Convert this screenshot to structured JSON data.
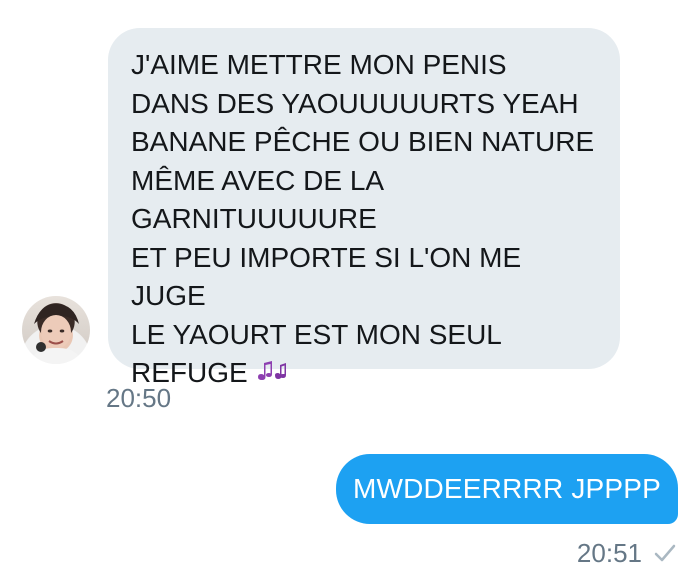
{
  "received_message": {
    "text": "J'AIME METTRE MON PENIS\nDANS DES YAOUUUUURTS YEAH\nBANANE PÊCHE OU BIEN NATURE\nMÊME AVEC DE LA\nGARNITUUUUURE\nET PEU IMPORTE SI L'ON ME JUGE\nLE YAOURT EST MON SEUL\nREFUGE",
    "emoji": "music-notes-icon",
    "time": "20:50"
  },
  "sent_message": {
    "text": "MWDDEERRRR JPPPP",
    "time": "20:51",
    "status_icon": "checkmark-icon"
  },
  "colors": {
    "received_bubble": "#e6ecf0",
    "sent_bubble": "#1da1f2",
    "timestamp": "#657786"
  }
}
